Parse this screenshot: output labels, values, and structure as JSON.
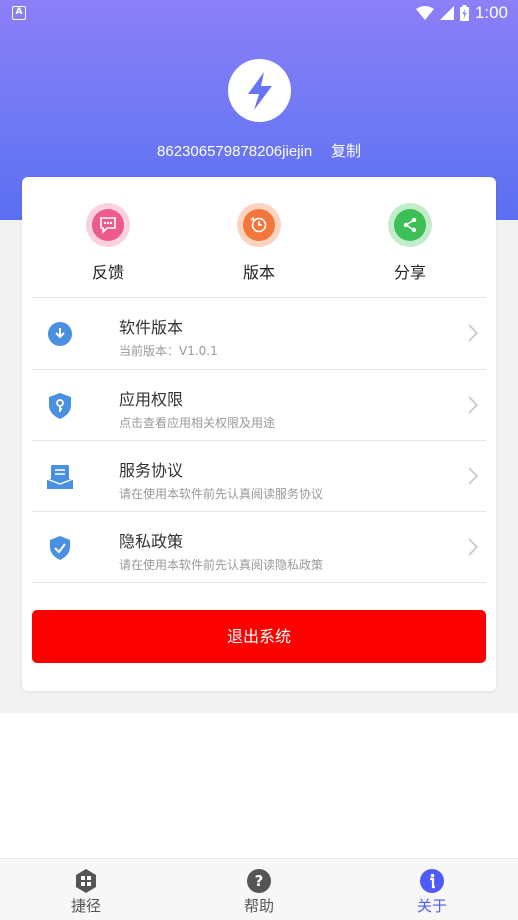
{
  "status_bar": {
    "time": "1:00",
    "left_icon": "A"
  },
  "header": {
    "device_id": "862306579878206jiejin",
    "copy_label": "复制"
  },
  "quick_actions": [
    {
      "label": "反馈",
      "icon": "feedback-icon",
      "color": "#ee5a8c"
    },
    {
      "label": "版本",
      "icon": "version-icon",
      "color": "#f3763c"
    },
    {
      "label": "分享",
      "icon": "share-icon",
      "color": "#3cbf55"
    }
  ],
  "settings": [
    {
      "title": "软件版本",
      "subtitle": "当前版本：V1.0.1",
      "icon": "download-icon"
    },
    {
      "title": "应用权限",
      "subtitle": "点击查看应用相关权限及用途",
      "icon": "key-shield-icon"
    },
    {
      "title": "服务协议",
      "subtitle": "请在使用本软件前先认真阅读服务协议",
      "icon": "document-icon"
    },
    {
      "title": "隐私政策",
      "subtitle": "请在使用本软件前先认真阅读隐私政策",
      "icon": "check-shield-icon"
    }
  ],
  "logout_label": "退出系统",
  "tabs": [
    {
      "label": "捷径",
      "icon": "shortcut-icon",
      "active": false
    },
    {
      "label": "帮助",
      "icon": "help-icon",
      "active": false
    },
    {
      "label": "关于",
      "icon": "info-icon",
      "active": true
    }
  ],
  "colors": {
    "accent": "#4f5bf5",
    "logout": "#fd0000",
    "icon_blue": "#4a90e2"
  }
}
